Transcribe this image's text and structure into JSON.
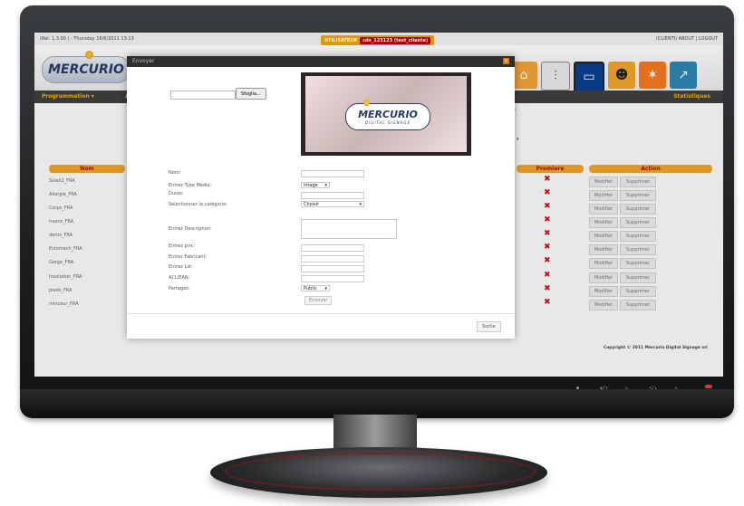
{
  "top": {
    "left_text": "(Rel: 1.3.00 ) - Thursday 16/6/2011 13:13",
    "user_label": "UTILISATEUR",
    "user_value": "cds_123123 (test_cliente)",
    "right_text": "(CLIENTI) ABOUT | LOGOUT"
  },
  "header": {
    "logo": "MERCURIO",
    "icons": [
      "home-icon",
      "mixer-icon",
      "monitor-icon",
      "users-icon",
      "network-icon",
      "chart-icon"
    ]
  },
  "nav": {
    "left": "Programmation  ▾",
    "left_extra": "A",
    "right": "Statistiques"
  },
  "table": {
    "headers": {
      "name": "Nom",
      "premiere": "Premiere",
      "action": "Action"
    },
    "rows": [
      "Soleil2_FRA",
      "Allergie_FRA",
      "Corps_FRA",
      "mains_FRA",
      "dents_FRA",
      "Estomach_FRA",
      "Gorge_FRA",
      "Insolation_FRA",
      "pieds_FRA",
      "minceur_FRA"
    ],
    "btn_modify": "Modifier",
    "btn_delete": "Supprimer"
  },
  "footer": {
    "copyright": "Copyright © 2011 Mercurio Digital Signage srl"
  },
  "modal": {
    "title": "Envoyer",
    "close": "×",
    "browse": "Sfoglia...",
    "preview_logo": "MERCURIO",
    "preview_sub": "DIGITAL SIGNAGE",
    "labels": {
      "name": "Nom:",
      "type": "Entrez Type Media:",
      "duration": "Durée:",
      "category": "Sélectionnez la catégorie:",
      "description": "Entrez Description:",
      "price": "Entrez prix:",
      "maker": "Entrez Fabricant:",
      "lot": "Entrez Lot:",
      "ean": "ACL/EAN:",
      "shared": "Partagés:"
    },
    "type_value": "image",
    "category_value": "Choisir",
    "shared_value": "Public",
    "send": "Envoyer",
    "close_btn": "Sortie"
  }
}
